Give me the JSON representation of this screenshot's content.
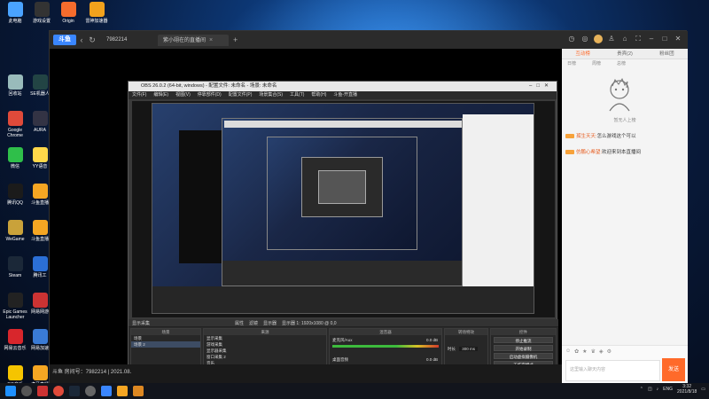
{
  "desktop_icons": [
    {
      "label": "此电脑",
      "color": "#4aa3ff"
    },
    {
      "label": "游戏设置",
      "color": "#333"
    },
    {
      "label": "Origin",
      "color": "#f56c2d"
    },
    {
      "label": "雷神加速器",
      "color": "#f2a21c"
    },
    {
      "label": "回收站",
      "color": "#9bb"
    },
    {
      "label": "SE机器人",
      "color": "#244"
    },
    {
      "label": "Google Chrome",
      "color": "#e04a3a"
    },
    {
      "label": "AURA",
      "color": "#334"
    },
    {
      "label": "微信",
      "color": "#2fbf4a"
    },
    {
      "label": "YY语音",
      "color": "#ffd84a"
    },
    {
      "label": "腾讯QQ",
      "color": "#1b1b1b"
    },
    {
      "label": "斗鱼直播",
      "color": "#f5a623"
    },
    {
      "label": "WeGame",
      "color": "#c9a23a"
    },
    {
      "label": "斗鱼直播",
      "color": "#f5a623"
    },
    {
      "label": "Steam",
      "color": "#1b2838"
    },
    {
      "label": "腾讯工",
      "color": "#2b6fd6"
    },
    {
      "label": "Epic Games Launcher",
      "color": "#222"
    },
    {
      "label": "网易网游",
      "color": "#c33"
    },
    {
      "label": "网易云音乐",
      "color": "#d8262c"
    },
    {
      "label": "网易加速",
      "color": "#3a7bd5"
    },
    {
      "label": "QQ音乐",
      "color": "#f5c400"
    },
    {
      "label": "虎牙直播",
      "color": "#f5a623"
    }
  ],
  "browser": {
    "logo": "斗鱼",
    "room_id": "7982214",
    "tab_title": "紫小翊在的直播间",
    "nav_back": "‹",
    "nav_reload": "↻",
    "tab_close": "×",
    "new_tab": "+",
    "stream_footer": "斗鱼 房间号：7982214 | 2021.08."
  },
  "chat": {
    "tabs": [
      "互动榜",
      "贵宾(2)",
      "粉丝团"
    ],
    "subtabs": [
      "日榜",
      "周榜",
      "总榜"
    ],
    "no_fans_text": "暂无人上榜",
    "messages": [
      {
        "user": "孤生天天:",
        "text": "怎么游戏这个可以"
      },
      {
        "user": "仿鹏心希望:",
        "text": "欢迎来到本直播间"
      }
    ],
    "input_placeholder": "这里输入聊天内容",
    "send_label": "发送"
  },
  "obs": {
    "title": "OBS 26.0.2 (64-bit, windows) - 配置文件: 未命名 - 场景: 未命名",
    "menu": [
      "文件(F)",
      "编辑(E)",
      "视图(V)",
      "停靠部件(D)",
      "配置文件(P)",
      "场景集合(S)",
      "工具(T)",
      "帮助(H)",
      "斗鱼-开直播"
    ],
    "source_bar": {
      "window_capture": "显示采集",
      "props": "属性",
      "filters": "滤镜",
      "display": "显示器",
      "display_value": "显示器 1: 1920x1080 @ 0,0"
    },
    "scenes_header": "场景",
    "scenes": [
      "场景",
      "场景 2"
    ],
    "sources_header": "来源",
    "sources": [
      "显示采集",
      "游戏采集",
      "显示器采集",
      "窗口采集 2",
      "音乐",
      "媒体源采集 2"
    ],
    "mixer_header": "混音器",
    "mixer": [
      {
        "name": "麦克风/Aux",
        "db": "0.0 dB"
      },
      {
        "name": "桌面音频",
        "db": "0.0 dB"
      }
    ],
    "transition_header": "转场特效",
    "transition_label": "时长",
    "transition_value": "300 ms",
    "controls_header": "控件",
    "controls": [
      "停止推流",
      "开始录制",
      "启动虚拟摄像机",
      "工作室模式",
      "设置",
      "退出"
    ]
  },
  "taskbar": {
    "lang": "ENG",
    "time": "3:32",
    "date": "2021/8/18"
  }
}
